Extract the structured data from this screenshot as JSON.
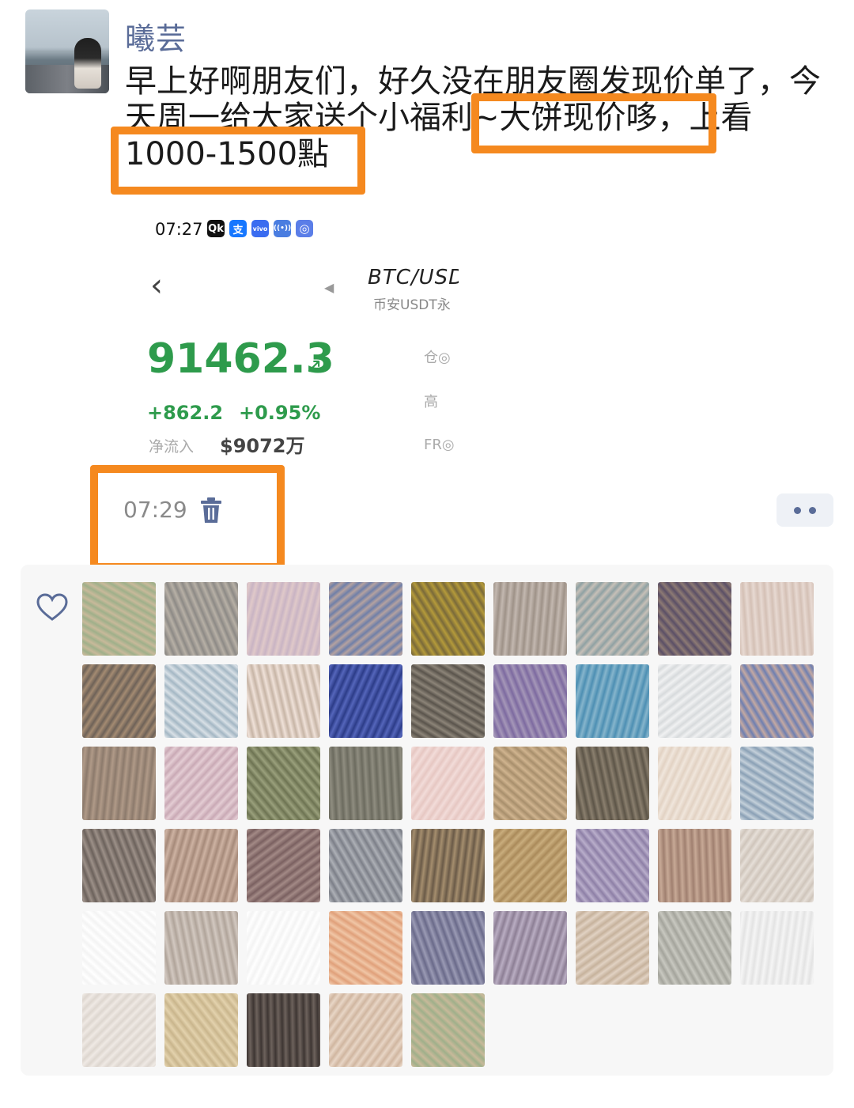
{
  "post": {
    "username": "曦芸",
    "text": "早上好啊朋友们，好久没在朋友圈发现价单了，今天周一给大家送个小福利~大饼现价哆，上看1000-1500點",
    "time": "07:29"
  },
  "screenshot": {
    "status_time": "07:27",
    "status_icons": [
      "app-icon-qk",
      "alipay-icon",
      "vivo-icon",
      "hotspot-icon",
      "browser-icon"
    ],
    "status_icon_glyphs": [
      "Qk",
      "支",
      "vivo",
      "((•))",
      "◎"
    ],
    "pair_title": "BTC/USD",
    "pair_subtitle": "币安USDT永",
    "price": "91462.3",
    "price_arrow": "↗",
    "change_abs": "+862.2",
    "change_pct": "+0.95%",
    "netflow_label": "净流入",
    "netflow_value": "$9072万",
    "side_labels": [
      "仓◎",
      "高",
      "FR◎"
    ]
  },
  "colors": {
    "highlight": "#f5891f",
    "username": "#5a6c98",
    "price_green": "#2e9b4c"
  },
  "likes": {
    "icon": "heart-outline-icon",
    "avatar_count": 49
  }
}
